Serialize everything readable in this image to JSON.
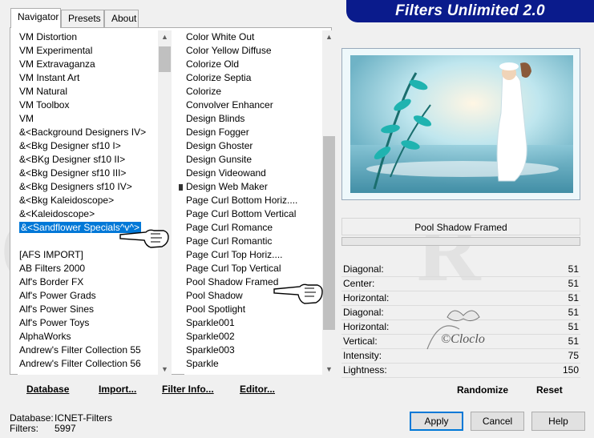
{
  "app": {
    "title": "Filters Unlimited 2.0"
  },
  "tabs": [
    {
      "label": "Navigator",
      "active": true
    },
    {
      "label": "Presets",
      "active": false
    },
    {
      "label": "About",
      "active": false
    }
  ],
  "categories": {
    "items": [
      "VM Distortion",
      "VM Experimental",
      "VM Extravaganza",
      "VM Instant Art",
      "VM Natural",
      "VM Toolbox",
      "VM",
      "&<Background Designers IV>",
      "&<Bkg Designer sf10 I>",
      "&<BKg Designer sf10 II>",
      "&<Bkg Designer sf10 III>",
      "&<Bkg Designers sf10 IV>",
      "&<Bkg Kaleidoscope>",
      "&<Kaleidoscope>",
      "&<Sandflower Specials^v^>",
      "",
      "[AFS IMPORT]",
      "AB Filters 2000",
      "Alf's Border FX",
      "Alf's Power Grads",
      "Alf's Power Sines",
      "Alf's Power Toys",
      "AlphaWorks",
      "Andrew's Filter Collection 55",
      "Andrew's Filter Collection 56"
    ],
    "selected": "&<Sandflower Specials^v^>"
  },
  "filters": {
    "items": [
      "Color White Out",
      "Color Yellow Diffuse",
      "Colorize Old",
      "Colorize Septia",
      "Colorize",
      "Convolver Enhancer",
      "Design Blinds",
      "Design Fogger",
      "Design Ghoster",
      "Design Gunsite",
      "Design Videowand",
      "Design Web Maker",
      "Page Curl Bottom Horiz....",
      "Page Curl Bottom Vertical",
      "Page Curl Romance",
      "Page Curl Romantic",
      "Page Curl Top Horiz....",
      "Page Curl Top Vertical",
      "Pool Shadow Framed",
      "Pool Shadow",
      "Pool Spotlight",
      "Sparkle001",
      "Sparkle002",
      "Sparkle003",
      "Sparkle"
    ],
    "highlighted": "Pool Shadow Framed"
  },
  "bottom_links": {
    "database": "Database",
    "import": "Import...",
    "filter_info": "Filter Info...",
    "editor": "Editor..."
  },
  "preview": {
    "filter_name": "Pool Shadow Framed"
  },
  "parameters": [
    {
      "label": "Diagonal:",
      "value": "51"
    },
    {
      "label": "Center:",
      "value": "51"
    },
    {
      "label": "Horizontal:",
      "value": "51"
    },
    {
      "label": "Diagonal:",
      "value": "51"
    },
    {
      "label": "Horizontal:",
      "value": "51"
    },
    {
      "label": "Vertical:",
      "value": "51"
    },
    {
      "label": "Intensity:",
      "value": "75"
    },
    {
      "label": "Lightness:",
      "value": "150"
    }
  ],
  "actions": {
    "randomize": "Randomize",
    "reset": "Reset"
  },
  "status": {
    "database_label": "Database:",
    "database_value": "ICNET-Filters",
    "filters_label": "Filters:",
    "filters_value": "5997"
  },
  "dialog_buttons": {
    "apply": "Apply",
    "cancel": "Cancel",
    "help": "Help"
  },
  "watermark": {
    "signature": "©Cloclo"
  },
  "colors": {
    "banner": "#0a1b8c",
    "selection": "#0078d7"
  }
}
